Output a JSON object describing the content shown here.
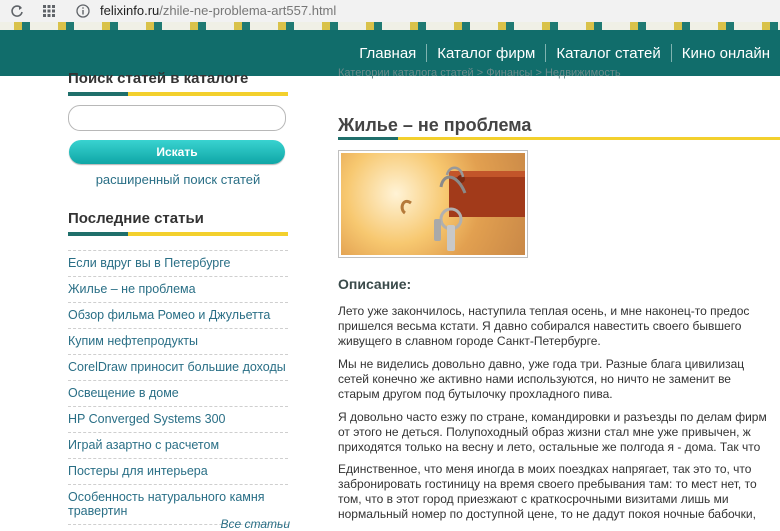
{
  "browser": {
    "url_host": "felixinfo.ru",
    "url_path": "/zhile-ne-problema-art557.html"
  },
  "nav": {
    "items": [
      "Главная",
      "Каталог фирм",
      "Каталог статей",
      "Кино онлайн"
    ]
  },
  "search": {
    "title": "Поиск статей в каталоге",
    "button_label": "Искать",
    "advanced_link": "расширенный поиск статей"
  },
  "recent": {
    "title": "Последние статьи",
    "items": [
      "Если вдруг вы в Петербурге",
      "Жилье – не проблема",
      "Обзор фильма Ромео и Джульетта",
      "Купим нефтепродукты",
      "CorelDraw приносит большие доходы",
      "Освещение в доме",
      "HP Converged Systems 300",
      "Играй азартно с расчетом",
      "Постеры для интерьера",
      "Особенность натурального камня травертин"
    ],
    "all_link": "Все статьи"
  },
  "article": {
    "breadcrumbs": "Категории каталога статей > Финансы > Недвижимость",
    "title": "Жилье – не проблема",
    "description_title": "Описание:",
    "paragraphs": [
      [
        "Лето уже закончилось, наступила теплая осень, и мне наконец-то предос",
        "пришелся весьма кстати. Я давно собирался навестить своего бывшего",
        "живущего в славном городе Санкт-Петербурге."
      ],
      [
        "Мы не виделись довольно давно, уже года три. Разные блага цивилизац",
        "сетей конечно же активно нами используются, но ничто не заменит ве",
        "старым другом под бутылочку прохладного пива."
      ],
      [
        "Я довольно часто езжу по стране, командировки и разъезды по делам фирм",
        "от этого не деться. Полупоходный образ жизни стал мне уже привычен, ж",
        "приходятся только на весну и лето, остальные же полгода я - дома. Так что"
      ],
      [
        "Единственное, что меня иногда в моих поездках напрягает, так это то, что",
        "забронировать гостиницу на время своего пребывания там: то мест нет, то",
        "том, что в этот город приезжают с краткосрочными визитами лишь ми",
        "нормальный номер по доступной цене, то не дадут покоя ночные бабочки,"
      ]
    ]
  }
}
